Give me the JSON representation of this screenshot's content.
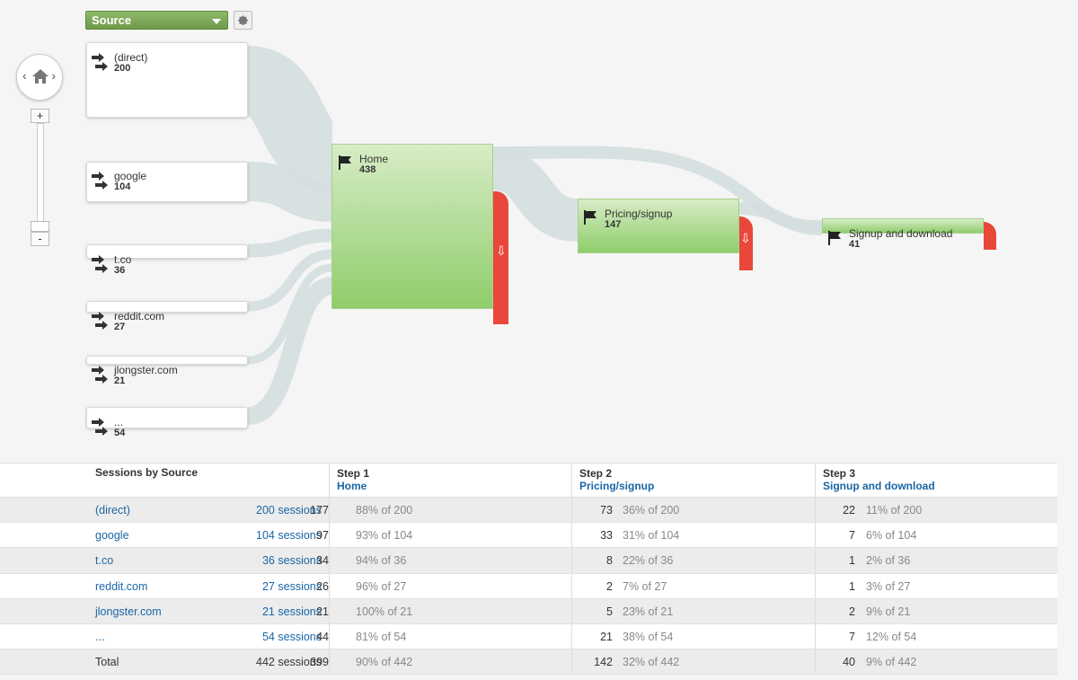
{
  "toolbar": {
    "source_label": "Source"
  },
  "zoom": {
    "plus": "+",
    "minus": "-"
  },
  "sources": [
    {
      "label": "(direct)",
      "value": "200"
    },
    {
      "label": "google",
      "value": "104"
    },
    {
      "label": "t.co",
      "value": "36"
    },
    {
      "label": "reddit.com",
      "value": "27"
    },
    {
      "label": "jlongster.com",
      "value": "21"
    },
    {
      "label": "...",
      "value": "54"
    }
  ],
  "steps": [
    {
      "label": "Home",
      "value": "438"
    },
    {
      "label": "Pricing/signup",
      "value": "147"
    },
    {
      "label": "Signup and download",
      "value": "41"
    }
  ],
  "table": {
    "header": "Sessions by Source",
    "steps": [
      {
        "title": "Step 1",
        "sub": "Home"
      },
      {
        "title": "Step 2",
        "sub": "Pricing/signup"
      },
      {
        "title": "Step 3",
        "sub": "Signup and download"
      }
    ],
    "rows": [
      {
        "source": "(direct)",
        "sessions": "200 sessions",
        "s1": "177",
        "p1": "88% of 200",
        "s2": "73",
        "p2": "36% of 200",
        "s3": "22",
        "p3": "11% of 200"
      },
      {
        "source": "google",
        "sessions": "104 sessions",
        "s1": "97",
        "p1": "93% of 104",
        "s2": "33",
        "p2": "31% of 104",
        "s3": "7",
        "p3": "6% of 104"
      },
      {
        "source": "t.co",
        "sessions": "36 sessions",
        "s1": "34",
        "p1": "94% of 36",
        "s2": "8",
        "p2": "22% of 36",
        "s3": "1",
        "p3": "2% of 36"
      },
      {
        "source": "reddit.com",
        "sessions": "27 sessions",
        "s1": "26",
        "p1": "96% of 27",
        "s2": "2",
        "p2": "7% of 27",
        "s3": "1",
        "p3": "3% of 27"
      },
      {
        "source": "jlongster.com",
        "sessions": "21 sessions",
        "s1": "21",
        "p1": "100% of 21",
        "s2": "5",
        "p2": "23% of 21",
        "s3": "2",
        "p3": "9% of 21"
      },
      {
        "source": "...",
        "sessions": "54 sessions",
        "s1": "44",
        "p1": "81% of 54",
        "s2": "21",
        "p2": "38% of 54",
        "s3": "7",
        "p3": "12% of 54"
      }
    ],
    "total": {
      "source": "Total",
      "sessions": "442 sessions",
      "s1": "399",
      "p1": "90% of 442",
      "s2": "142",
      "p2": "32% of 442",
      "s3": "40",
      "p3": "9% of 442"
    }
  },
  "colors": {
    "step_green": "#8fcd6b",
    "dropoff_red": "#e8473a",
    "flow_link": "#d5dfdf",
    "link_blue": "#1a66a6"
  }
}
